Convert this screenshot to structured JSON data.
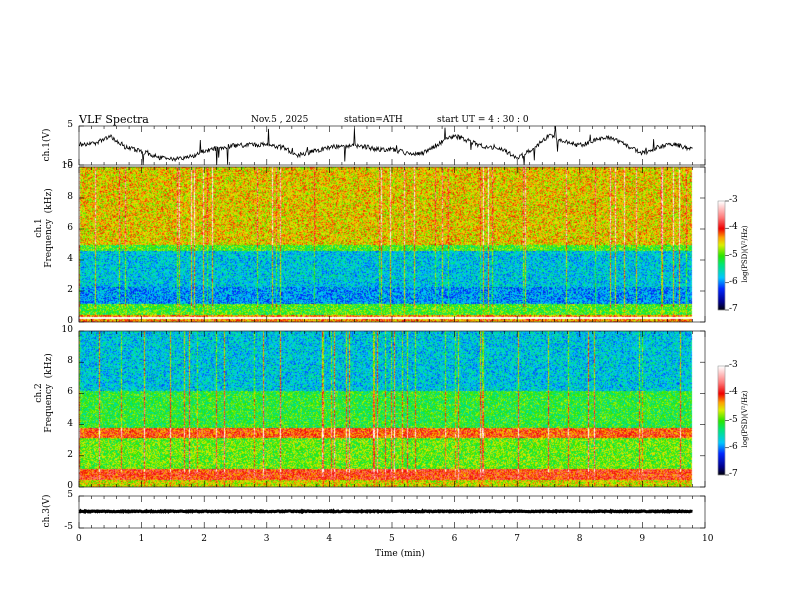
{
  "header": {
    "title": "VLF  Spectra",
    "date": "Nov.5  , 2025",
    "station": "station=ATH",
    "start_ut": "start  UT  =   4  : 30 : 0"
  },
  "chart_data": [
    {
      "type": "line",
      "ylabel": "ch.1(V)",
      "ylim": [
        -5,
        5
      ],
      "yticks": [
        "5",
        "-5"
      ],
      "xlim": [
        0,
        10
      ],
      "x": [
        0,
        0.25,
        0.5,
        0.75,
        1,
        1.25,
        1.5,
        1.75,
        2,
        2.25,
        2.5,
        2.75,
        3,
        3.25,
        3.5,
        3.75,
        4,
        4.25,
        4.5,
        4.75,
        5,
        5.25,
        5.5,
        5.75,
        6,
        6.25,
        6.5,
        6.75,
        7,
        7.25,
        7.5,
        7.75,
        8,
        8.25,
        8.5,
        8.75,
        9,
        9.25,
        9.5,
        9.75,
        9.8
      ],
      "y": [
        0.3,
        0.5,
        2.5,
        -0.5,
        -1.5,
        -3,
        -3.5,
        -3,
        -1.5,
        -0.5,
        0,
        0.2,
        0.2,
        -0.5,
        -2.5,
        -1.5,
        -0.5,
        0,
        0,
        -1,
        -1,
        -2,
        -2,
        0.5,
        2.5,
        1,
        -0.5,
        -1,
        -3,
        -1,
        2.5,
        1,
        0,
        1.5,
        2,
        0,
        -2,
        -0.5,
        0.5,
        -1,
        -0.5
      ]
    },
    {
      "type": "heatmap",
      "ylabel": "ch.1\nFrequency  (kHz)",
      "ylim": [
        0,
        10
      ],
      "yticks": [
        "0",
        "2",
        "4",
        "6",
        "8",
        "10"
      ],
      "xlim": [
        0,
        10
      ],
      "data_extent_min": 9.8,
      "bands_khz": [
        {
          "from": 5.0,
          "to": 10,
          "level": -4.5
        },
        {
          "from": 2.3,
          "to": 4.6,
          "level": -5.7
        },
        {
          "from": 1.2,
          "to": 2.3,
          "level": -5.9
        },
        {
          "from": 0.5,
          "to": 1.2,
          "level": -5.0
        },
        {
          "from": 0.0,
          "to": 0.5,
          "level": -4.3
        }
      ],
      "colorbar": {
        "label": "log(PSD)(V²/Hz)",
        "ticks": [
          "-3",
          "-4",
          "-5",
          "-6",
          "-7"
        ],
        "range": [
          -7,
          -3
        ]
      }
    },
    {
      "type": "heatmap",
      "ylabel": "ch.2\nFrequency  (kHz)",
      "ylim": [
        0,
        10
      ],
      "yticks": [
        "0",
        "2",
        "4",
        "6",
        "8",
        "10"
      ],
      "xlim": [
        0,
        10
      ],
      "data_extent_min": 9.8,
      "bands_khz": [
        {
          "from": 6.2,
          "to": 10,
          "level": -5.7
        },
        {
          "from": 3.8,
          "to": 6.2,
          "level": -5.1
        },
        {
          "from": 3.2,
          "to": 3.8,
          "level": -4.1
        },
        {
          "from": 1.2,
          "to": 3.2,
          "level": -4.9
        },
        {
          "from": 0.5,
          "to": 1.2,
          "level": -4.0
        },
        {
          "from": 0.0,
          "to": 0.5,
          "level": -4.6
        }
      ],
      "colorbar": {
        "label": "log(PSD)(V²/Hz)",
        "ticks": [
          "-3",
          "-4",
          "-5",
          "-6",
          "-7"
        ],
        "range": [
          -7,
          -3
        ]
      }
    },
    {
      "type": "line",
      "ylabel": "ch.3(V)",
      "ylim": [
        -5,
        5
      ],
      "yticks": [
        "5",
        "-5"
      ],
      "xlim": [
        0,
        10
      ],
      "x": [
        0,
        9.8
      ],
      "y": [
        0.2,
        0.2
      ],
      "xlabel": "Time  (min)",
      "xticks": [
        "0",
        "1",
        "2",
        "3",
        "4",
        "5",
        "6",
        "7",
        "8",
        "9",
        "10"
      ]
    }
  ]
}
